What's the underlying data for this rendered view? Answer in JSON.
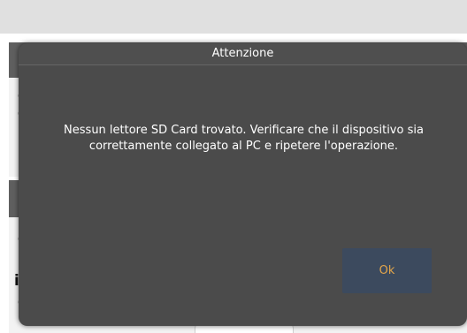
{
  "background": {
    "fragments": [
      "c",
      "c",
      "c",
      ":",
      "i:",
      "o"
    ]
  },
  "dialog": {
    "title": "Attenzione",
    "message_line1": "Nessun lettore SD Card trovato. Verificare che il dispositivo sia",
    "message_line2": "correttamente collegato al PC e ripetere l'operazione.",
    "ok_label": "Ok"
  },
  "colors": {
    "dialog_bg": "#4b4b4b",
    "ok_button_bg": "#3c4a5e",
    "ok_button_text": "#e3a54a",
    "header_bg": "#5f5f5f"
  }
}
